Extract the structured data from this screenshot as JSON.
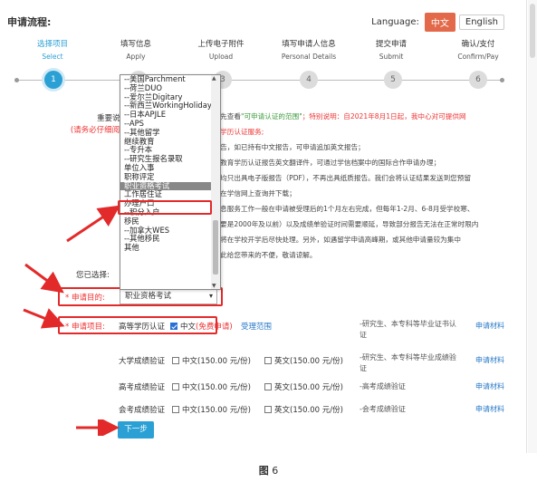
{
  "title": "申请流程:",
  "language": {
    "label": "Language:",
    "zh": "中文",
    "en": "English"
  },
  "steps": [
    {
      "zh": "选择项目",
      "en": "Select",
      "num": "1"
    },
    {
      "zh": "填写信息",
      "en": "Apply",
      "num": "2"
    },
    {
      "zh": "上传电子附件",
      "en": "Upload",
      "num": "3"
    },
    {
      "zh": "填写申请人信息",
      "en": "Personal Details",
      "num": "4"
    },
    {
      "zh": "提交申请",
      "en": "Submit",
      "num": "5"
    },
    {
      "zh": "确认/支付",
      "en": "Confirm/Pay",
      "num": "6"
    }
  ],
  "notice": {
    "label": "重要说明:",
    "label_red": "(请务必仔细阅读)",
    "l1a": "，请先查看",
    "l1b": "\"可申请认证的范围\"",
    "l1c": "；特别说明：自2021年8月1日起，我中心对可提供网",
    "l2": "高等学历认证服务;",
    "l3": "文报告，如已持有中文报告，可申请追加英文报告；",
    "l4": "高等教育学历认证报告英文翻译件，可通过学信档案中的国际合作申请办理；",
    "l5": "报告均只出具电子版报告（PDF），不再出具纸质报告。我们会将认证结果发送到您预留",
    "l6": "编号在学信网上查询并下载；",
    "l7": "息信息服务工作一般在申请被受理后的1个月左右完成，但每年1-2月、6-8月受学校寒、",
    "l8": "（主要是2000年及以前）以及成绩单验证时间需要顺延，导致部分报告无法在正常时限内",
    "l9": "中心将在学校开学后尽快处理。另外，如遇留学申请高峰期，或其他申请量较为集中",
    "l10": "，对此给您带来的不便，敬请谅解。"
  },
  "dropdown": {
    "items": [
      "--美国Parchment",
      "--荷兰DUO",
      "--爱尔兰Digitary",
      "--新西兰WorkingHoliday",
      "--日本APJLE",
      "--APS",
      "--其他留学",
      "继续教育",
      "--专升本",
      "--研究生报名录取",
      "单位入事",
      "职称评定",
      "职业资格考试",
      "工作居住证",
      "办理户口",
      "--积分入户",
      "移民",
      "--加拿大WES",
      "--其他移民",
      "其他"
    ],
    "selected_index": 12
  },
  "form": {
    "chosen_label": "您已选择:",
    "purpose_label": "* 申请目的:",
    "purpose_value": "职业资格考试",
    "project_label": "* 申请项目:"
  },
  "rows": [
    {
      "name": "高等学历认证",
      "zh_option": "中文(免费申请)",
      "zh_checked": true,
      "scope": "受理范围",
      "desc": "-研究生、本专科等毕业证书认证",
      "material": "申请材料"
    },
    {
      "name": "大学成绩验证",
      "zh_option": "中文(150.00 元/份)",
      "zh_checked": false,
      "en_option": "英文(150.00 元/份)",
      "desc": "-研究生、本专科等毕业成绩验证",
      "material": "申请材料"
    },
    {
      "name": "高考成绩验证",
      "zh_option": "中文(150.00 元/份)",
      "zh_checked": false,
      "en_option": "英文(150.00 元/份)",
      "desc": "-高考成绩验证",
      "material": "申请材料"
    },
    {
      "name": "会考成绩验证",
      "zh_option": "中文(150.00 元/份)",
      "zh_checked": false,
      "en_option": "英文(150.00 元/份)",
      "desc": "-会考成绩验证",
      "material": "申请材料"
    }
  ],
  "next_label": "下一步",
  "caption": {
    "prefix": "图",
    "num": "6"
  },
  "colors": {
    "accent": "#2ba0d4",
    "highlight": "#e32a2a",
    "lang_active": "#e2694a"
  }
}
